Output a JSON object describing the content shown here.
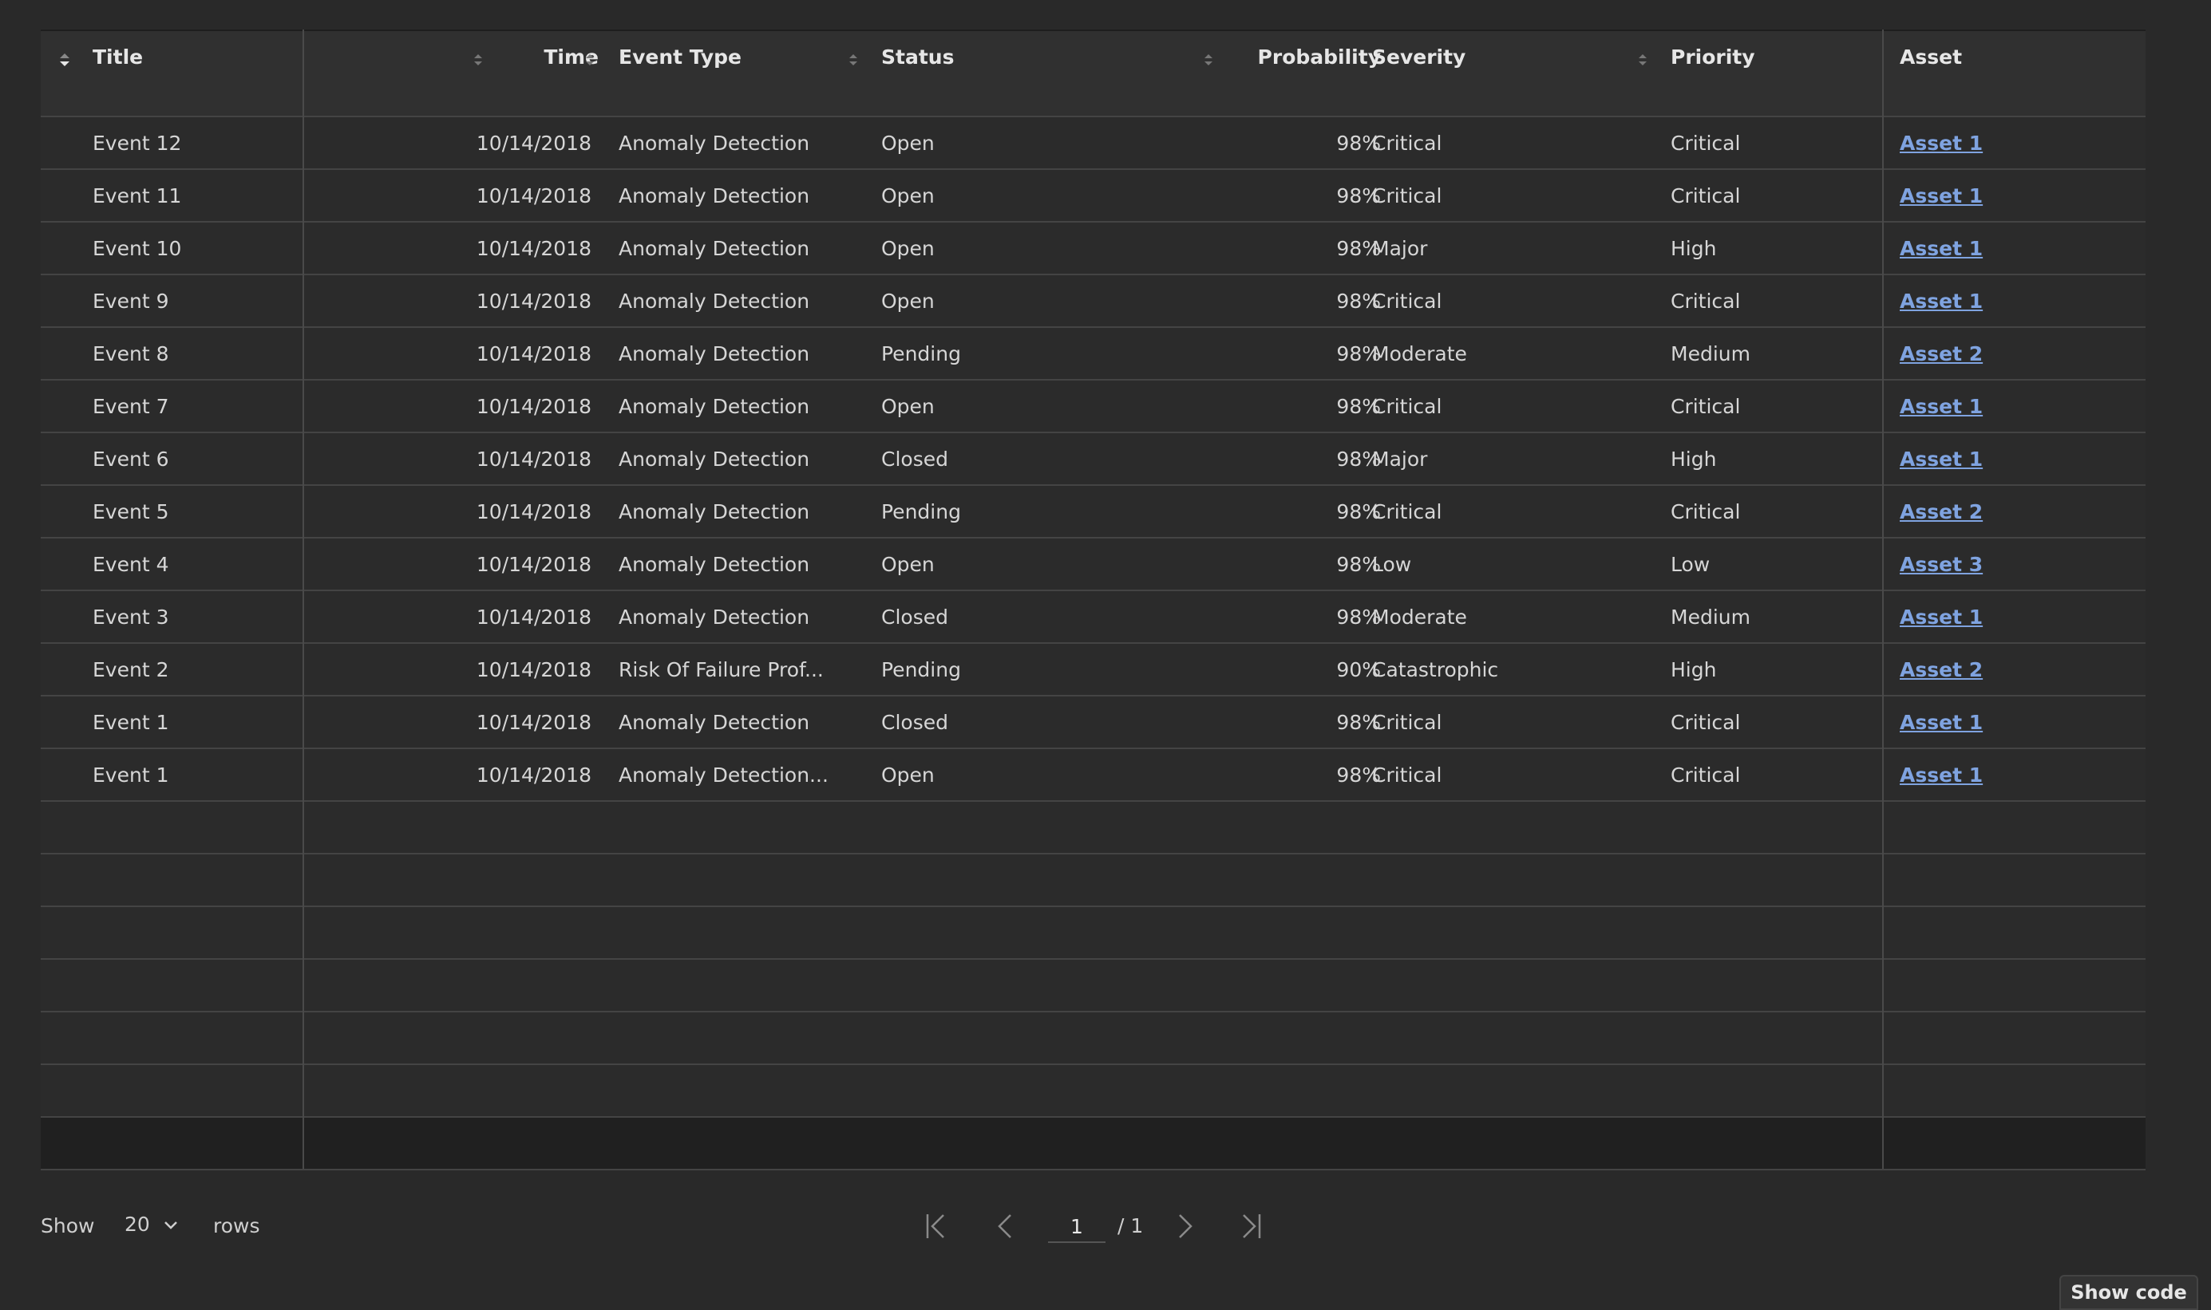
{
  "columns": [
    {
      "key": "title",
      "label": "Title"
    },
    {
      "key": "time",
      "label": "Time"
    },
    {
      "key": "event_type",
      "label": "Event Type"
    },
    {
      "key": "status",
      "label": "Status"
    },
    {
      "key": "probability",
      "label": "Probability"
    },
    {
      "key": "severity",
      "label": "Severity"
    },
    {
      "key": "priority",
      "label": "Priority"
    },
    {
      "key": "asset",
      "label": "Asset"
    }
  ],
  "rows": [
    {
      "title": "Event 12",
      "time": "10/14/2018",
      "event_type": "Anomaly Detection",
      "status": "Open",
      "probability": "98%",
      "severity": "Critical",
      "priority": "Critical",
      "asset": "Asset 1"
    },
    {
      "title": "Event 11",
      "time": "10/14/2018",
      "event_type": "Anomaly Detection",
      "status": "Open",
      "probability": "98%",
      "severity": "Critical",
      "priority": "Critical",
      "asset": "Asset 1"
    },
    {
      "title": "Event 10",
      "time": "10/14/2018",
      "event_type": "Anomaly Detection",
      "status": "Open",
      "probability": "98%",
      "severity": "Major",
      "priority": "High",
      "asset": "Asset 1"
    },
    {
      "title": "Event 9",
      "time": "10/14/2018",
      "event_type": "Anomaly Detection",
      "status": "Open",
      "probability": "98%",
      "severity": "Critical",
      "priority": "Critical",
      "asset": "Asset 1"
    },
    {
      "title": "Event 8",
      "time": "10/14/2018",
      "event_type": "Anomaly Detection",
      "status": "Pending",
      "probability": "98%",
      "severity": "Moderate",
      "priority": "Medium",
      "asset": "Asset 2"
    },
    {
      "title": "Event 7",
      "time": "10/14/2018",
      "event_type": "Anomaly Detection",
      "status": "Open",
      "probability": "98%",
      "severity": "Critical",
      "priority": "Critical",
      "asset": "Asset 1"
    },
    {
      "title": "Event 6",
      "time": "10/14/2018",
      "event_type": "Anomaly Detection",
      "status": "Closed",
      "probability": "98%",
      "severity": "Major",
      "priority": "High",
      "asset": "Asset 1"
    },
    {
      "title": "Event 5",
      "time": "10/14/2018",
      "event_type": "Anomaly Detection",
      "status": "Pending",
      "probability": "98%",
      "severity": "Critical",
      "priority": "Critical",
      "asset": "Asset 2"
    },
    {
      "title": "Event 4",
      "time": "10/14/2018",
      "event_type": "Anomaly Detection",
      "status": "Open",
      "probability": "98%",
      "severity": "Low",
      "priority": "Low",
      "asset": "Asset 3"
    },
    {
      "title": "Event 3",
      "time": "10/14/2018",
      "event_type": "Anomaly Detection",
      "status": "Closed",
      "probability": "98%",
      "severity": "Moderate",
      "priority": "Medium",
      "asset": "Asset 1"
    },
    {
      "title": "Event 2",
      "time": "10/14/2018",
      "event_type": "Risk Of Failure Prof...",
      "status": "Pending",
      "probability": "90%",
      "severity": "Catastrophic",
      "priority": "High",
      "asset": "Asset 2"
    },
    {
      "title": "Event 1",
      "time": "10/14/2018",
      "event_type": "Anomaly Detection",
      "status": "Closed",
      "probability": "98%",
      "severity": "Critical",
      "priority": "Critical",
      "asset": "Asset 1"
    },
    {
      "title": "Event 1",
      "time": "10/14/2018",
      "event_type": "Anomaly Detection...",
      "status": "Open",
      "probability": "98%",
      "severity": "Critical",
      "priority": "Critical",
      "asset": "Asset 1"
    }
  ],
  "empty_rows": 6,
  "pager": {
    "show_label": "Show",
    "rows_value": "20",
    "rows_label": "rows",
    "current_page": "1",
    "total_pages": "/ 1"
  },
  "show_code_label": "Show code",
  "colors": {
    "background": "#292929",
    "header": "#303030",
    "link": "#7fa3e0"
  }
}
